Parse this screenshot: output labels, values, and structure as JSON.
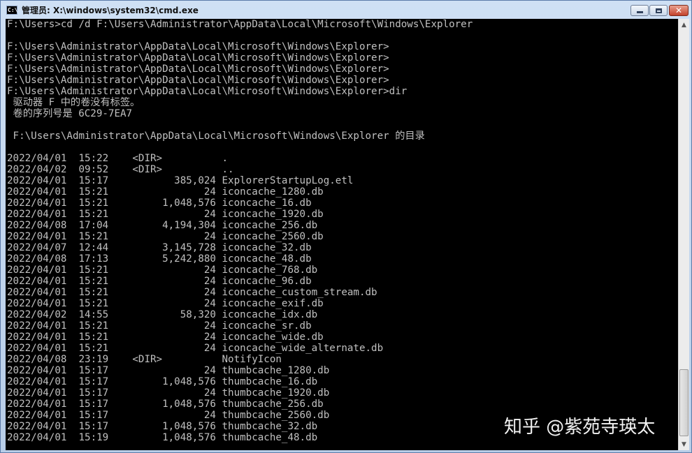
{
  "window": {
    "title": "管理员: X:\\windows\\system32\\cmd.exe",
    "icon": "cmd-icon",
    "icon_text": "C:\\",
    "controls": {
      "minimize": "minimize-icon",
      "maximize": "maximize-icon",
      "close": "close-icon",
      "close_glyph": "✕"
    }
  },
  "console": {
    "lines": [
      "F:\\Users>cd /d F:\\Users\\Administrator\\AppData\\Local\\Microsoft\\Windows\\Explorer",
      "",
      "F:\\Users\\Administrator\\AppData\\Local\\Microsoft\\Windows\\Explorer>",
      "F:\\Users\\Administrator\\AppData\\Local\\Microsoft\\Windows\\Explorer>",
      "F:\\Users\\Administrator\\AppData\\Local\\Microsoft\\Windows\\Explorer>",
      "F:\\Users\\Administrator\\AppData\\Local\\Microsoft\\Windows\\Explorer>",
      "F:\\Users\\Administrator\\AppData\\Local\\Microsoft\\Windows\\Explorer>dir",
      " 驱动器 F 中的卷没有标签。",
      " 卷的序列号是 6C29-7EA7",
      "",
      " F:\\Users\\Administrator\\AppData\\Local\\Microsoft\\Windows\\Explorer 的目录",
      "",
      "2022/04/01  15:22    <DIR>          .",
      "2022/04/02  09:52    <DIR>          ..",
      "2022/04/01  15:17           385,024 ExplorerStartupLog.etl",
      "2022/04/01  15:21                24 iconcache_1280.db",
      "2022/04/01  15:21         1,048,576 iconcache_16.db",
      "2022/04/01  15:21                24 iconcache_1920.db",
      "2022/04/08  17:04         4,194,304 iconcache_256.db",
      "2022/04/01  15:21                24 iconcache_2560.db",
      "2022/04/07  12:44         3,145,728 iconcache_32.db",
      "2022/04/08  17:13         5,242,880 iconcache_48.db",
      "2022/04/01  15:21                24 iconcache_768.db",
      "2022/04/01  15:21                24 iconcache_96.db",
      "2022/04/01  15:21                24 iconcache_custom_stream.db",
      "2022/04/01  15:21                24 iconcache_exif.db",
      "2022/04/02  14:55            58,320 iconcache_idx.db",
      "2022/04/01  15:21                24 iconcache_sr.db",
      "2022/04/01  15:21                24 iconcache_wide.db",
      "2022/04/01  15:21                24 iconcache_wide_alternate.db",
      "2022/04/08  23:19    <DIR>          NotifyIcon",
      "2022/04/01  15:17                24 thumbcache_1280.db",
      "2022/04/01  15:17         1,048,576 thumbcache_16.db",
      "2022/04/01  15:17                24 thumbcache_1920.db",
      "2022/04/01  15:17         1,048,576 thumbcache_256.db",
      "2022/04/01  15:17                24 thumbcache_2560.db",
      "2022/04/01  15:17         1,048,576 thumbcache_32.db",
      "2022/04/01  15:19         1,048,576 thumbcache_48.db"
    ]
  },
  "scrollbar": {
    "up": "scroll-up-icon",
    "down": "scroll-down-icon",
    "up_glyph": "▲",
    "down_glyph": "▼"
  },
  "watermark": "知乎 @紫苑寺瑛太",
  "colors": {
    "console_bg": "#000000",
    "console_text": "#c0c0c0",
    "close_button": "#c3422c"
  }
}
